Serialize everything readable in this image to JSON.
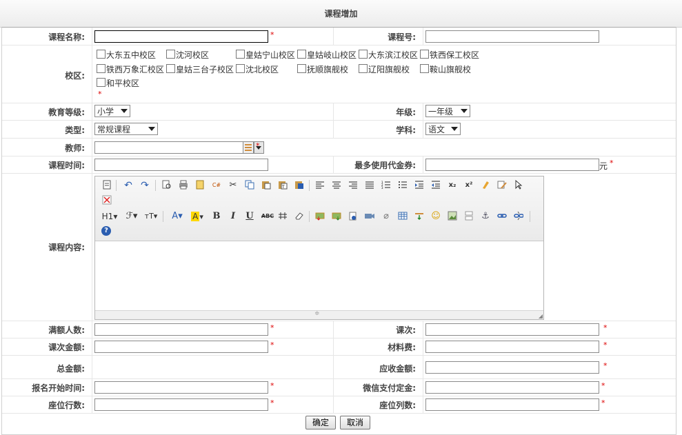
{
  "title": "课程增加",
  "form": {
    "course_name": {
      "label": "课程名称:",
      "value": "",
      "required": "*"
    },
    "course_no": {
      "label": "课程号:",
      "value": ""
    },
    "campus": {
      "label": "校区:",
      "options": [
        "大东五中校区",
        "沈河校区",
        "皇姑宁山校区",
        "皇姑岐山校区",
        "大东滨江校区",
        "铁西保工校区",
        "铁西万象汇校区",
        "皇姑三台子校区",
        "沈北校区",
        "抚顺旗舰校",
        "辽阳旗舰校",
        "鞍山旗舰校",
        "和平校区"
      ],
      "required": "*"
    },
    "edu_level": {
      "label": "教育等级:",
      "value": "小学"
    },
    "grade": {
      "label": "年级:",
      "value": "一年级"
    },
    "type": {
      "label": "类型:",
      "value": "常规课程"
    },
    "subject": {
      "label": "学科:",
      "value": "语文"
    },
    "teacher": {
      "label": "教师:",
      "value": "",
      "required": "*"
    },
    "course_time": {
      "label": "课程时间:",
      "value": ""
    },
    "max_voucher": {
      "label": "最多使用代金券:",
      "value": "",
      "unit": "元",
      "required": "*"
    },
    "course_content": {
      "label": "课程内容:",
      "value": ""
    },
    "full_count": {
      "label": "满额人数:",
      "value": "",
      "required": "*"
    },
    "sessions": {
      "label": "课次:",
      "value": "",
      "required": "*"
    },
    "session_amount": {
      "label": "课次金额:",
      "value": "",
      "required": "*"
    },
    "material_fee": {
      "label": "材料费:",
      "value": "",
      "required": "*"
    },
    "total_amount": {
      "label": "总金额:",
      "value": ""
    },
    "receivable": {
      "label": "应收金额:",
      "value": "",
      "required": "*"
    },
    "signup_start": {
      "label": "报名开始时间:",
      "value": "",
      "required": "*"
    },
    "wechat_deposit": {
      "label": "微信支付定金:",
      "value": "",
      "required": "*"
    },
    "seat_rows": {
      "label": "座位行数:",
      "value": "",
      "required": "*"
    },
    "seat_cols": {
      "label": "座位列数:",
      "value": "",
      "required": "*"
    }
  },
  "buttons": {
    "confirm": "确定",
    "cancel": "取消"
  },
  "editor_toolbar": {
    "heading": "H1",
    "font_family": "ℱ",
    "font_size": "тT",
    "font_color": "A",
    "highlight": "A",
    "bold": "B",
    "italic": "I",
    "underline": "U",
    "strike": "ABC",
    "sub": "x₂",
    "sup": "x²",
    "help": "?"
  },
  "colors": {
    "required": "#dd0000",
    "highlight": "#ffd800",
    "link_blue": "#2a5db0"
  }
}
